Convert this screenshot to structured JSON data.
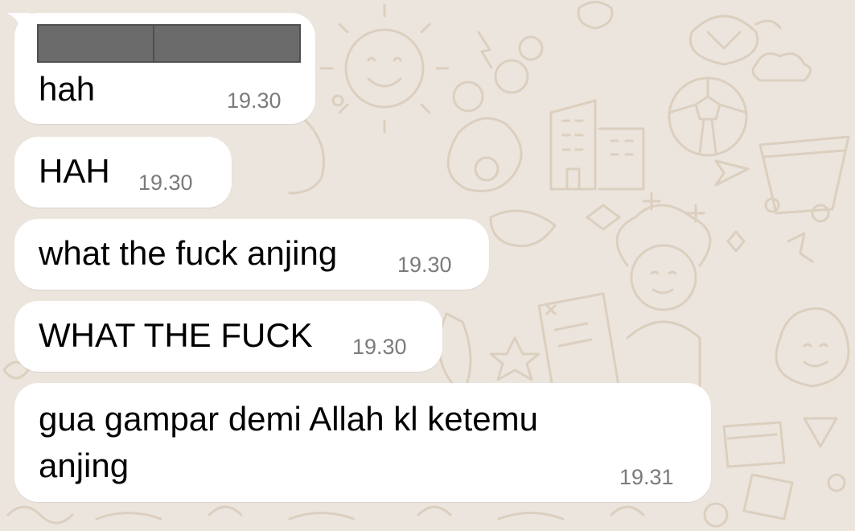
{
  "chat": {
    "messages": [
      {
        "text": "hah",
        "time": "19.30",
        "redacted_quote": true
      },
      {
        "text": "HAH",
        "time": "19.30"
      },
      {
        "text": "what the fuck anjing",
        "time": "19.30"
      },
      {
        "text": "WHAT THE FUCK",
        "time": "19.30"
      },
      {
        "text_line1": "gua gampar demi Allah kl ketemu",
        "text_line2": "anjing",
        "time": "19.31"
      }
    ]
  },
  "colors": {
    "background": "#ece5dd",
    "bubble": "#ffffff",
    "text": "#000000",
    "time": "#7b7b7b",
    "redaction": "#6b6b6b",
    "doodle": "#dccfbf"
  },
  "icons": [
    "sun-doodle",
    "turtle-doodle",
    "soccer-ball-doodle",
    "building-doodle",
    "egg-doodle",
    "flower-pot-doodle",
    "person-doodle",
    "book-doodle",
    "paper-plane-doodle",
    "avocado-doodle"
  ]
}
